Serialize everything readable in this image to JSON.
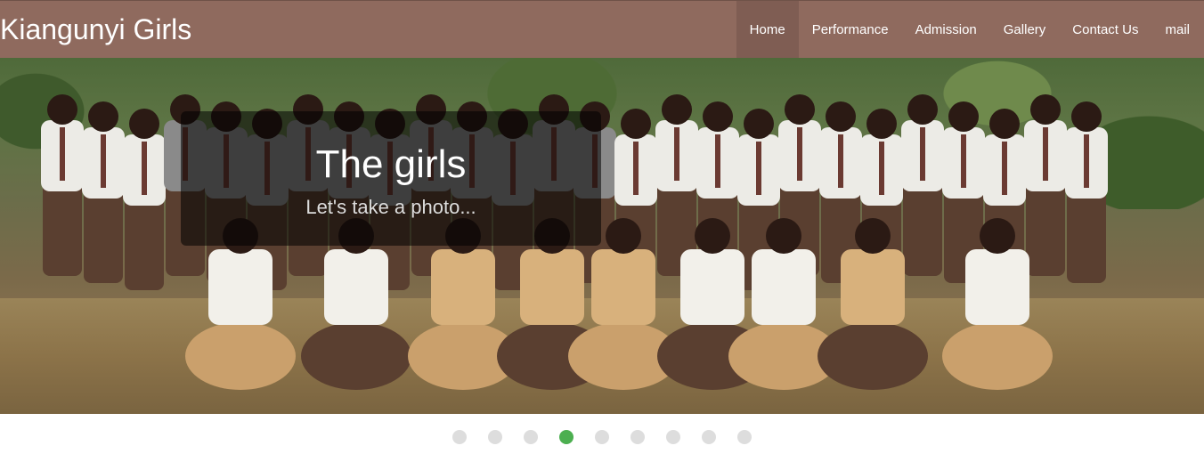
{
  "brand": "Kiangunyi Girls",
  "nav": [
    {
      "label": "Home",
      "active": true
    },
    {
      "label": "Performance",
      "active": false
    },
    {
      "label": "Admission",
      "active": false
    },
    {
      "label": "Gallery",
      "active": false
    },
    {
      "label": "Contact Us",
      "active": false
    },
    {
      "label": "mail",
      "active": false
    }
  ],
  "slide": {
    "title": "The girls",
    "subtitle": "Let's take a photo..."
  },
  "carousel": {
    "count": 9,
    "active_index": 3,
    "active_color": "#4caf50",
    "inactive_color": "#dddddd"
  },
  "colors": {
    "navbar": "#8f6a5e",
    "nav_active": "#7f5d53"
  }
}
